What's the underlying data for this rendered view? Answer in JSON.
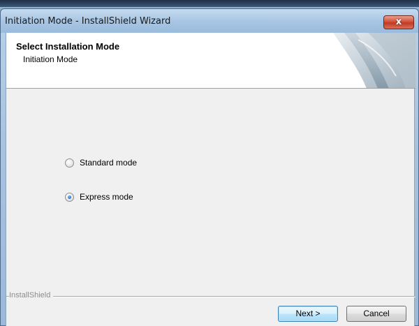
{
  "window": {
    "title": "Initiation Mode - InstallShield Wizard",
    "close_label": "x"
  },
  "header": {
    "title": "Select Installation Mode",
    "subtitle": "Initiation Mode"
  },
  "options": [
    {
      "label": "Standard mode",
      "selected": false
    },
    {
      "label": "Express mode",
      "selected": true
    }
  ],
  "branding": "InstallShield",
  "buttons": {
    "next": "Next >",
    "cancel": "Cancel"
  },
  "icons": {
    "header": "installshield-graphic-icon",
    "close": "close-icon"
  }
}
